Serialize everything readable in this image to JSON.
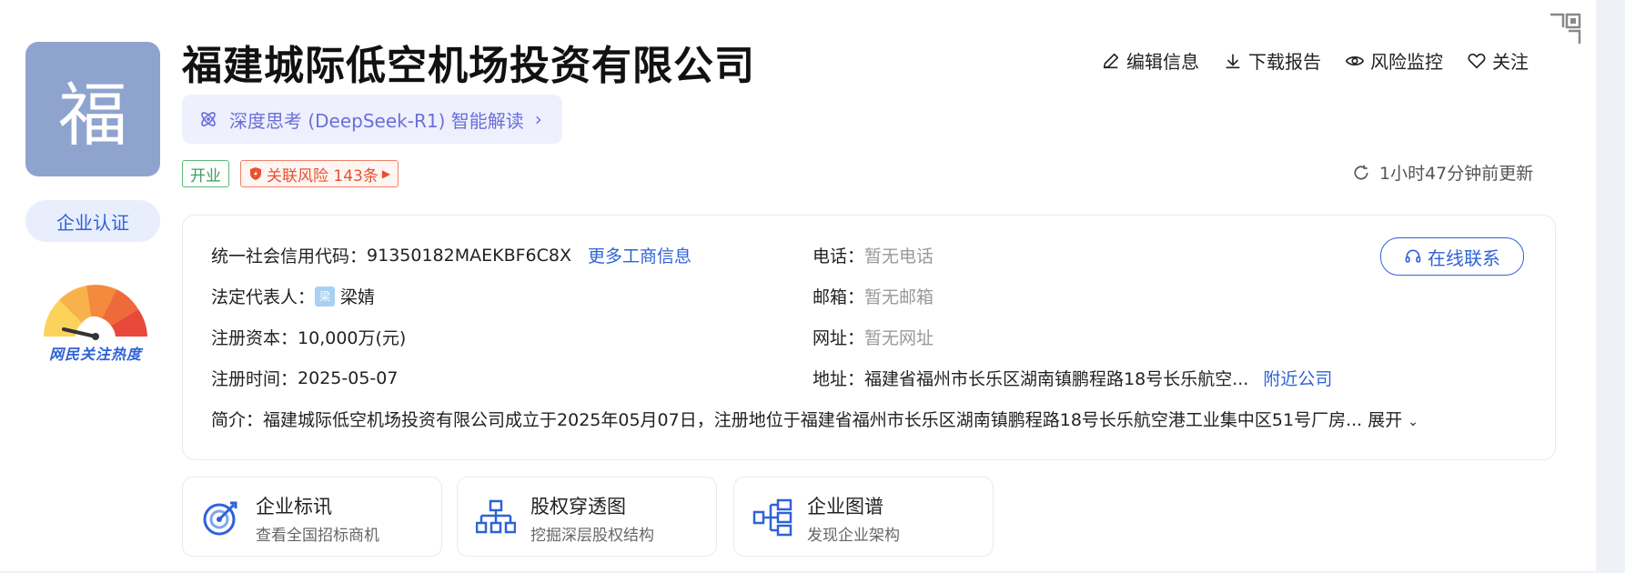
{
  "company": {
    "logo_char": "福",
    "name": "福建城际低空机场投资有限公司",
    "verify_label": "企业认证",
    "heat_label": "网民关注热度"
  },
  "ai": {
    "label": "深度思考 (DeepSeek-R1) 智能解读"
  },
  "tags": {
    "status": "开业",
    "risk": "关联风险 143条"
  },
  "actions": {
    "edit": "编辑信息",
    "download": "下载报告",
    "monitor": "风险监控",
    "follow": "关注"
  },
  "updated": "1小时47分钟前更新",
  "info": {
    "credit_label": "统一社会信用代码：",
    "credit_value": "91350182MAEKBF6C8X",
    "more_link": "更多工商信息",
    "legal_label": "法定代表人：",
    "legal_avatar": "梁",
    "legal_value": "梁婧",
    "capital_label": "注册资本：",
    "capital_value": "10,000万(元)",
    "date_label": "注册时间：",
    "date_value": "2025-05-07",
    "phone_label": "电话：",
    "phone_value": "暂无电话",
    "email_label": "邮箱：",
    "email_value": "暂无邮箱",
    "site_label": "网址：",
    "site_value": "暂无网址",
    "addr_label": "地址：",
    "addr_value": "福建省福州市长乐区湖南镇鹏程路18号长乐航空...",
    "nearby_link": "附近公司",
    "intro_label": "简介：",
    "intro_value": "福建城际低空机场投资有限公司成立于2025年05月07日，注册地位于福建省福州市长乐区湖南镇鹏程路18号长乐航空港工业集中区51号厂房...",
    "expand_label": "展开",
    "contact_button": "在线联系"
  },
  "features": [
    {
      "title": "企业标讯",
      "sub": "查看全国招标商机",
      "icon": "target-icon"
    },
    {
      "title": "股权穿透图",
      "sub": "挖掘深层股权结构",
      "icon": "equity-tree-icon"
    },
    {
      "title": "企业图谱",
      "sub": "发现企业架构",
      "icon": "org-graph-icon"
    }
  ],
  "colors": {
    "accent": "#2f62d8",
    "logo_bg": "#8ea4ce",
    "status_green": "#3aa05a",
    "risk_red": "#e8502f",
    "ai_purple": "#6b6fd8"
  }
}
